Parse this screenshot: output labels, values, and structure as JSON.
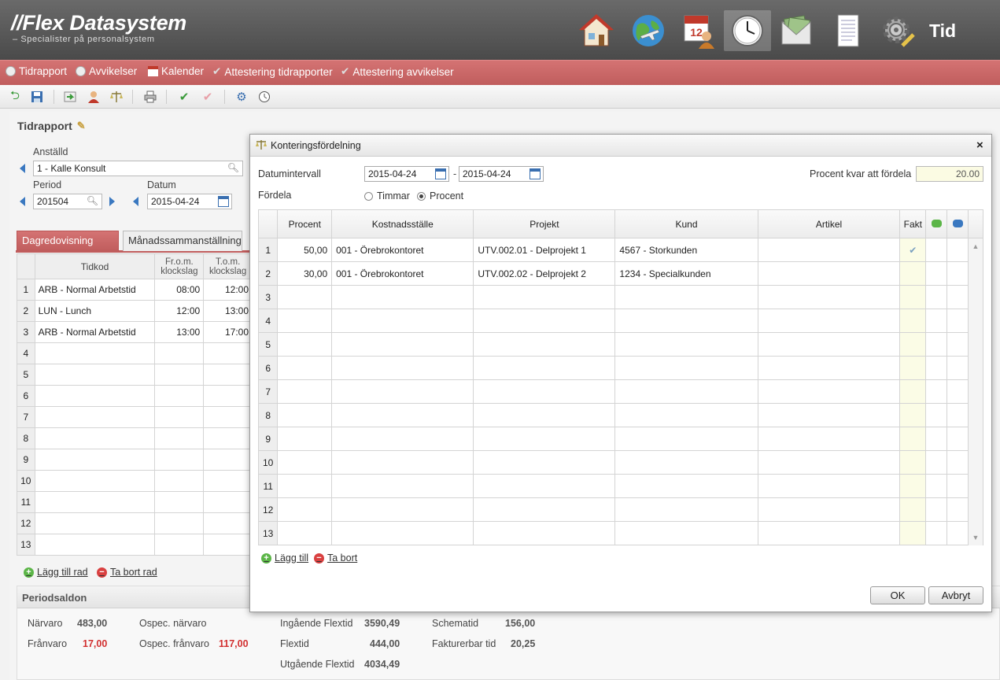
{
  "header": {
    "logo": "//Flex Datasystem",
    "tagline": "– Specialister på personalsystem",
    "app_title": "Tid",
    "icons": [
      "home-icon",
      "globe-travel-icon",
      "calendar-person-icon",
      "clock-icon",
      "money-envelope-icon",
      "document-icon",
      "gear-pencil-icon"
    ]
  },
  "nav": {
    "items": [
      "Tidrapport",
      "Avvikelser",
      "Kalender",
      "Attestering tidrapporter",
      "Attestering avvikelser"
    ]
  },
  "page": {
    "title": "Tidrapport",
    "employee_label": "Anställd",
    "employee_value": "1 - Kalle Konsult",
    "period_label": "Period",
    "period_value": "201504",
    "date_label": "Datum",
    "date_value": "2015-04-24",
    "tabs": [
      "Dagredovisning",
      "Månadssammanställning"
    ],
    "grid_headers": {
      "tidkod": "Tidkod",
      "from": "Fr.o.m. klockslag",
      "tom": "T.o.m. klockslag"
    },
    "rows": [
      {
        "n": "1",
        "code": "ARB - Normal Arbetstid",
        "from": "08:00",
        "to": "12:00"
      },
      {
        "n": "2",
        "code": "LUN - Lunch",
        "from": "12:00",
        "to": "13:00"
      },
      {
        "n": "3",
        "code": "ARB - Normal Arbetstid",
        "from": "13:00",
        "to": "17:00"
      },
      {
        "n": "4",
        "code": "",
        "from": "",
        "to": ""
      },
      {
        "n": "5",
        "code": "",
        "from": "",
        "to": ""
      },
      {
        "n": "6",
        "code": "",
        "from": "",
        "to": ""
      },
      {
        "n": "7",
        "code": "",
        "from": "",
        "to": ""
      },
      {
        "n": "8",
        "code": "",
        "from": "",
        "to": ""
      },
      {
        "n": "9",
        "code": "",
        "from": "",
        "to": ""
      },
      {
        "n": "10",
        "code": "",
        "from": "",
        "to": ""
      },
      {
        "n": "11",
        "code": "",
        "from": "",
        "to": ""
      },
      {
        "n": "12",
        "code": "",
        "from": "",
        "to": ""
      },
      {
        "n": "13",
        "code": "",
        "from": "",
        "to": ""
      }
    ],
    "add_row": "Lägg till rad",
    "remove_row": "Ta bort rad"
  },
  "period_balance": {
    "title": "Periodsaldon",
    "narvaro_label": "Närvaro",
    "narvaro": "483,00",
    "franvaro_label": "Frånvaro",
    "franvaro": "17,00",
    "ospec_narvaro_label": "Ospec. närvaro",
    "ospec_franvaro_label": "Ospec. frånvaro",
    "ospec_franvaro": "117,00",
    "ingaende_label": "Ingående Flextid",
    "ingaende": "3590,49",
    "flextid_label": "Flextid",
    "flextid": "444,00",
    "utgaende_label": "Utgående Flextid",
    "utgaende": "4034,49",
    "schematid_label": "Schematid",
    "schematid": "156,00",
    "fakturerbar_label": "Fakturerbar tid",
    "fakturerbar": "20,25"
  },
  "dialog": {
    "title": "Konteringsfördelning",
    "close": "×",
    "date_interval_label": "Datumintervall",
    "date_from": "2015-04-24",
    "date_sep": "-",
    "date_to": "2015-04-24",
    "remaining_label": "Procent kvar att fördela",
    "remaining_value": "20.00",
    "distribute_label": "Fördela",
    "option_hours": "Timmar",
    "option_percent": "Procent",
    "selected_option": "Procent",
    "headers": [
      "Procent",
      "Kostnadsställe",
      "Projekt",
      "Kund",
      "Artikel",
      "Fakt"
    ],
    "rows": [
      {
        "n": "1",
        "pct": "50,00",
        "cost": "001 - Örebrokontoret",
        "proj": "UTV.002.01 - Delprojekt 1",
        "cust": "4567 - Storkunden",
        "art": "",
        "fakt": true
      },
      {
        "n": "2",
        "pct": "30,00",
        "cost": "001 - Örebrokontoret",
        "proj": "UTV.002.02 - Delprojekt 2",
        "cust": "1234 - Specialkunden",
        "art": "",
        "fakt": false
      },
      {
        "n": "3",
        "pct": "",
        "cost": "",
        "proj": "",
        "cust": "",
        "art": "",
        "fakt": false
      },
      {
        "n": "4",
        "pct": "",
        "cost": "",
        "proj": "",
        "cust": "",
        "art": "",
        "fakt": false
      },
      {
        "n": "5",
        "pct": "",
        "cost": "",
        "proj": "",
        "cust": "",
        "art": "",
        "fakt": false
      },
      {
        "n": "6",
        "pct": "",
        "cost": "",
        "proj": "",
        "cust": "",
        "art": "",
        "fakt": false
      },
      {
        "n": "7",
        "pct": "",
        "cost": "",
        "proj": "",
        "cust": "",
        "art": "",
        "fakt": false
      },
      {
        "n": "8",
        "pct": "",
        "cost": "",
        "proj": "",
        "cust": "",
        "art": "",
        "fakt": false
      },
      {
        "n": "9",
        "pct": "",
        "cost": "",
        "proj": "",
        "cust": "",
        "art": "",
        "fakt": false
      },
      {
        "n": "10",
        "pct": "",
        "cost": "",
        "proj": "",
        "cust": "",
        "art": "",
        "fakt": false
      },
      {
        "n": "11",
        "pct": "",
        "cost": "",
        "proj": "",
        "cust": "",
        "art": "",
        "fakt": false
      },
      {
        "n": "12",
        "pct": "",
        "cost": "",
        "proj": "",
        "cust": "",
        "art": "",
        "fakt": false
      },
      {
        "n": "13",
        "pct": "",
        "cost": "",
        "proj": "",
        "cust": "",
        "art": "",
        "fakt": false
      }
    ],
    "add": "Lägg till",
    "remove": "Ta bort",
    "ok": "OK",
    "cancel": "Avbryt"
  }
}
